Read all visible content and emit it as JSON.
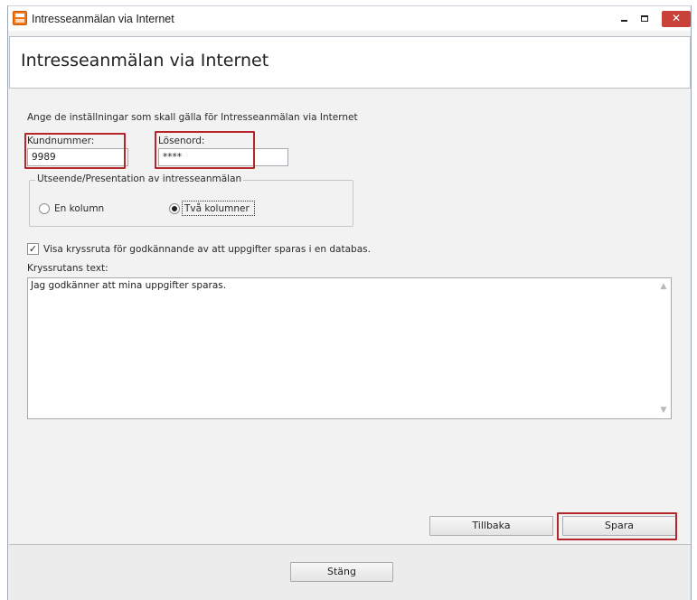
{
  "window": {
    "title": "Intresseanmälan via Internet",
    "close_glyph": "✕"
  },
  "header": {
    "title": "Intresseanmälan via Internet"
  },
  "main": {
    "instruction": "Ange de inställningar som skall gälla för Intresseanmälan via Internet",
    "kundnummer_label": "Kundnummer:",
    "kundnummer_value": "9989",
    "losenord_label": "Lösenord:",
    "losenord_value": "****",
    "layout_group": {
      "legend": "Utseende/Presentation av intresseanmälan",
      "options": [
        {
          "label": "En kolumn",
          "selected": false
        },
        {
          "label": "Två kolumner",
          "selected": true
        }
      ]
    },
    "consent_checkbox": {
      "label": "Visa kryssruta för godkännande av att uppgifter sparas i en databas.",
      "checked": true,
      "check_glyph": "✓"
    },
    "checkbox_text_label": "Kryssrutans text:",
    "checkbox_text_value": "Jag godkänner att mina uppgifter sparas.",
    "back_button": "Tillbaka",
    "save_button": "Spara"
  },
  "footer": {
    "close_button": "Stäng"
  },
  "colors": {
    "highlight": "#b5262a",
    "close_button": "#c9423a",
    "app_icon": "#f07a1a"
  },
  "icons": [
    "app-icon",
    "minimize-icon",
    "maximize-icon",
    "close-icon",
    "scroll-up-icon",
    "scroll-down-icon",
    "check-icon"
  ]
}
